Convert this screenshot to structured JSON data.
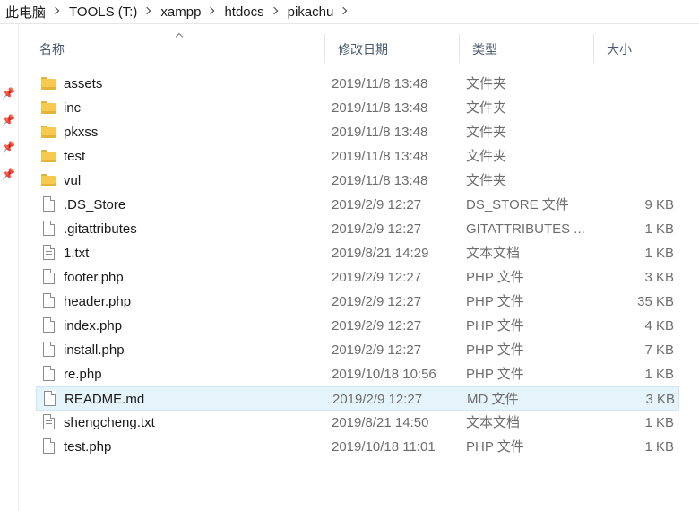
{
  "breadcrumb": [
    "此电脑",
    "TOOLS (T:)",
    "xampp",
    "htdocs",
    "pikachu"
  ],
  "columns": {
    "name": "名称",
    "date": "修改日期",
    "type": "类型",
    "size": "大小"
  },
  "rows": [
    {
      "name": "assets",
      "date": "2019/11/8 13:48",
      "type": "文件夹",
      "size": "",
      "kind": "folder"
    },
    {
      "name": "inc",
      "date": "2019/11/8 13:48",
      "type": "文件夹",
      "size": "",
      "kind": "folder"
    },
    {
      "name": "pkxss",
      "date": "2019/11/8 13:48",
      "type": "文件夹",
      "size": "",
      "kind": "folder"
    },
    {
      "name": "test",
      "date": "2019/11/8 13:48",
      "type": "文件夹",
      "size": "",
      "kind": "folder"
    },
    {
      "name": "vul",
      "date": "2019/11/8 13:48",
      "type": "文件夹",
      "size": "",
      "kind": "folder"
    },
    {
      "name": ".DS_Store",
      "date": "2019/2/9 12:27",
      "type": "DS_STORE 文件",
      "size": "9 KB",
      "kind": "file"
    },
    {
      "name": ".gitattributes",
      "date": "2019/2/9 12:27",
      "type": "GITATTRIBUTES ...",
      "size": "1 KB",
      "kind": "file"
    },
    {
      "name": "1.txt",
      "date": "2019/8/21 14:29",
      "type": "文本文档",
      "size": "1 KB",
      "kind": "txt"
    },
    {
      "name": "footer.php",
      "date": "2019/2/9 12:27",
      "type": "PHP 文件",
      "size": "3 KB",
      "kind": "file"
    },
    {
      "name": "header.php",
      "date": "2019/2/9 12:27",
      "type": "PHP 文件",
      "size": "35 KB",
      "kind": "file"
    },
    {
      "name": "index.php",
      "date": "2019/2/9 12:27",
      "type": "PHP 文件",
      "size": "4 KB",
      "kind": "file"
    },
    {
      "name": "install.php",
      "date": "2019/2/9 12:27",
      "type": "PHP 文件",
      "size": "7 KB",
      "kind": "file"
    },
    {
      "name": "re.php",
      "date": "2019/10/18 10:56",
      "type": "PHP 文件",
      "size": "1 KB",
      "kind": "file"
    },
    {
      "name": "README.md",
      "date": "2019/2/9 12:27",
      "type": "MD 文件",
      "size": "3 KB",
      "kind": "file",
      "selected": true
    },
    {
      "name": "shengcheng.txt",
      "date": "2019/8/21 14:50",
      "type": "文本文档",
      "size": "1 KB",
      "kind": "txt"
    },
    {
      "name": "test.php",
      "date": "2019/10/18 11:01",
      "type": "PHP 文件",
      "size": "1 KB",
      "kind": "file"
    }
  ],
  "icons": {
    "pin": "pin-icon",
    "folder": "folder-icon",
    "file": "file-icon",
    "text_file": "text-file-icon",
    "sort": "sort-ascending-icon",
    "breadcrumb_sep": "chevron-right-icon"
  }
}
